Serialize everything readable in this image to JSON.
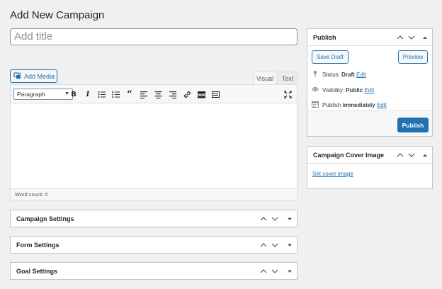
{
  "page": {
    "title": "Add New Campaign"
  },
  "title_field": {
    "placeholder": "Add title"
  },
  "editor": {
    "add_media_label": "Add Media",
    "tabs": {
      "visual": "Visual",
      "text": "Text"
    },
    "format_value": "Paragraph",
    "toolbar_icons": [
      "bold-icon",
      "italic-icon",
      "bulleted-list-icon",
      "numbered-list-icon",
      "blockquote-icon",
      "align-left-icon",
      "align-center-icon",
      "align-right-icon",
      "link-icon",
      "read-more-icon",
      "toolbar-toggle-icon",
      "fullscreen-icon"
    ],
    "word_count_label": "Word count: 0"
  },
  "publish": {
    "title": "Publish",
    "save_draft_label": "Save Draft",
    "preview_label": "Preview",
    "status_label": "Status:",
    "status_value": "Draft",
    "visibility_label": "Visibility:",
    "visibility_value": "Public",
    "publish_label": "Publish",
    "publish_when": "immediately",
    "edit_label": "Edit",
    "publish_button_label": "Publish"
  },
  "cover_image": {
    "title": "Campaign Cover Image",
    "set_label": "Set cover image"
  },
  "metaboxes": [
    {
      "title": "Campaign Settings"
    },
    {
      "title": "Form Settings"
    },
    {
      "title": "Goal Settings"
    }
  ],
  "colors": {
    "accent": "#2271b1",
    "background": "#f0f0f1",
    "border": "#c3c4c7"
  }
}
